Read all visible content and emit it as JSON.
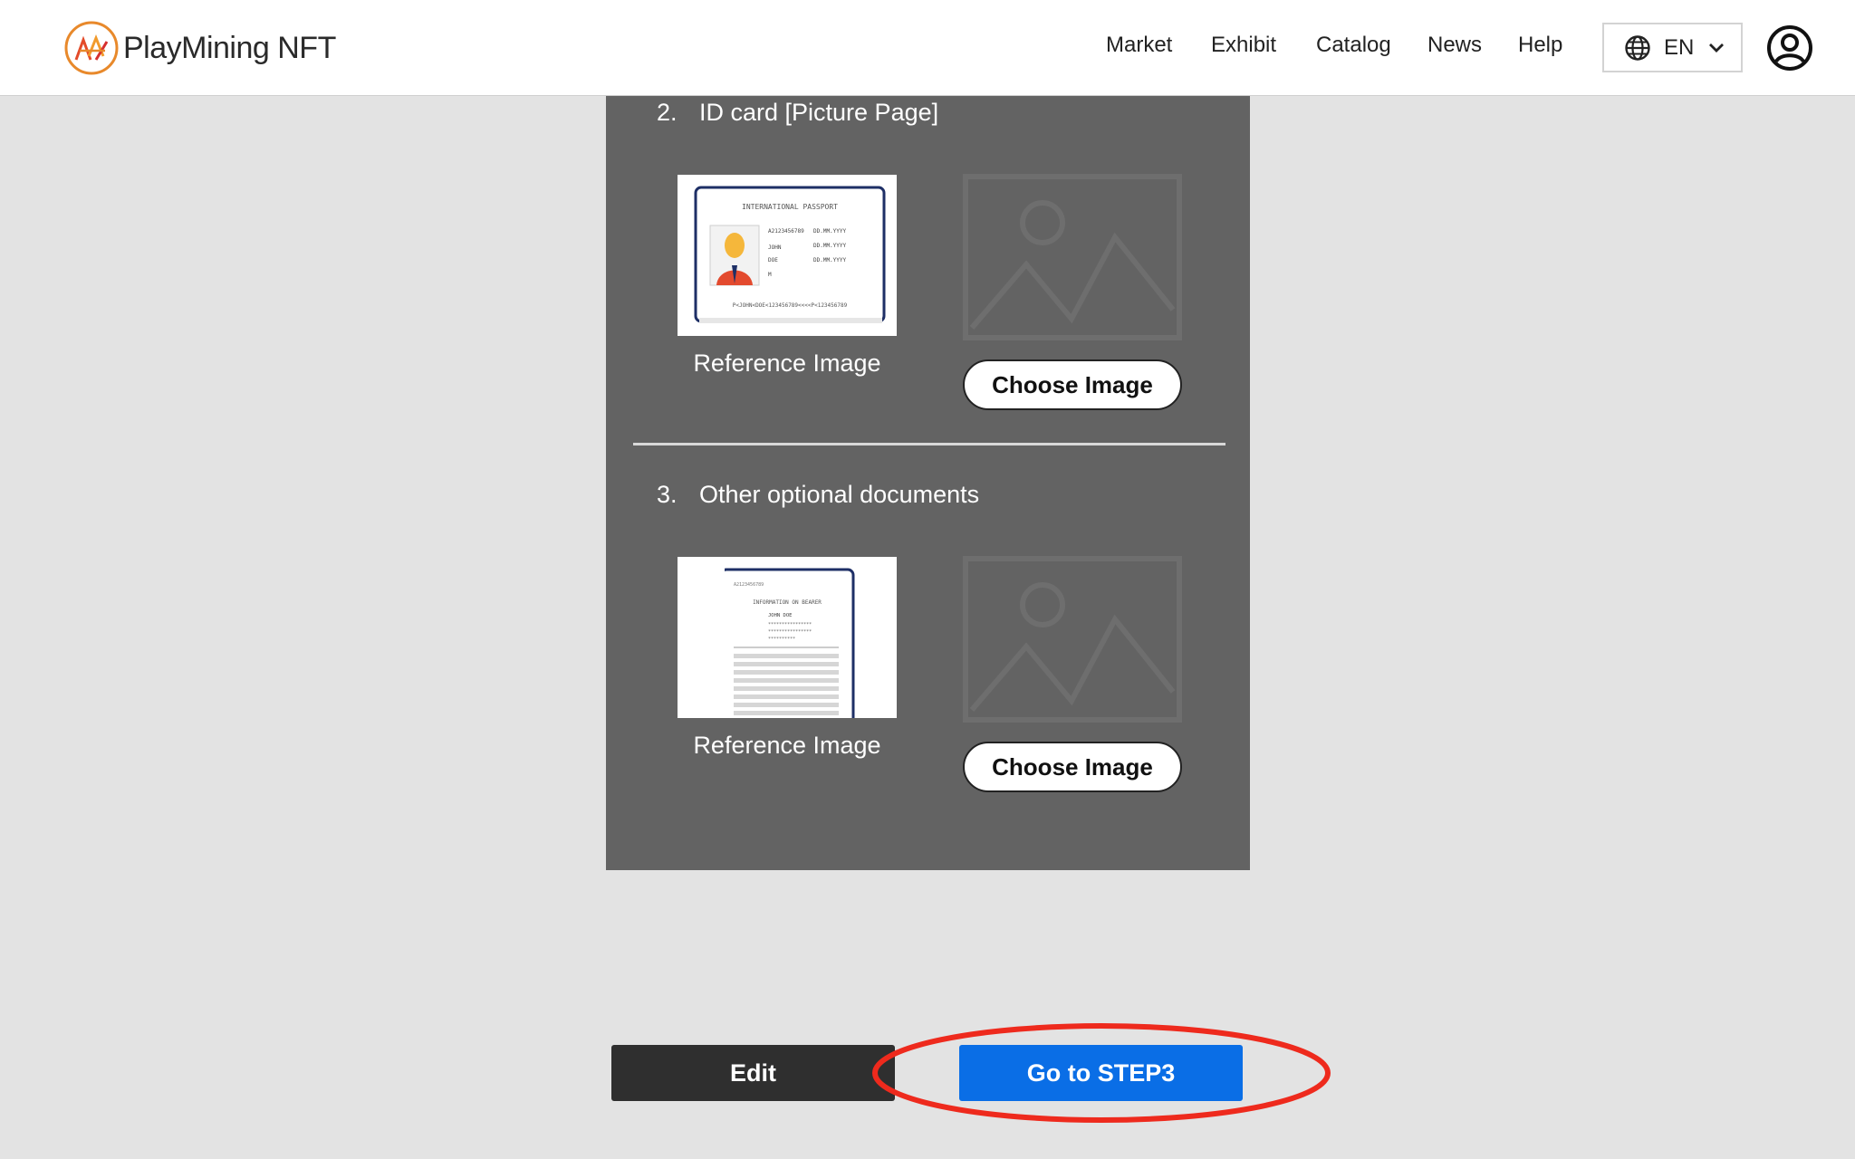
{
  "header": {
    "brand": "PlayMining NFT",
    "nav": [
      "Market",
      "Exhibit",
      "Catalog",
      "News",
      "Help"
    ],
    "language": "EN"
  },
  "sections": [
    {
      "number": "2.",
      "title": "ID card [Picture Page]",
      "reference_label": "Reference Image",
      "choose_label": "Choose Image"
    },
    {
      "number": "3.",
      "title": "Other optional documents",
      "reference_label": "Reference Image",
      "choose_label": "Choose Image"
    }
  ],
  "passport_sample": {
    "heading": "INTERNATIONAL PASSPORT",
    "fields": [
      "A2123456789",
      "JOHN",
      "DOE",
      "M"
    ],
    "dates": [
      "DD.MM.YYYY",
      "DD.MM.YYYY",
      "DD.MM.YYYY"
    ],
    "mrz": "P<JOHN<DOE<123456789<<<<P<123456789"
  },
  "document_sample": {
    "heading": "INFORMATION ON BEARER",
    "name": "JOHN DOE",
    "number": "A2123456789"
  },
  "footer": {
    "edit_label": "Edit",
    "next_label": "Go to STEP3"
  },
  "colors": {
    "panel": "#636363",
    "primary": "#0a6ee6",
    "highlight": "#ee2a1d"
  }
}
